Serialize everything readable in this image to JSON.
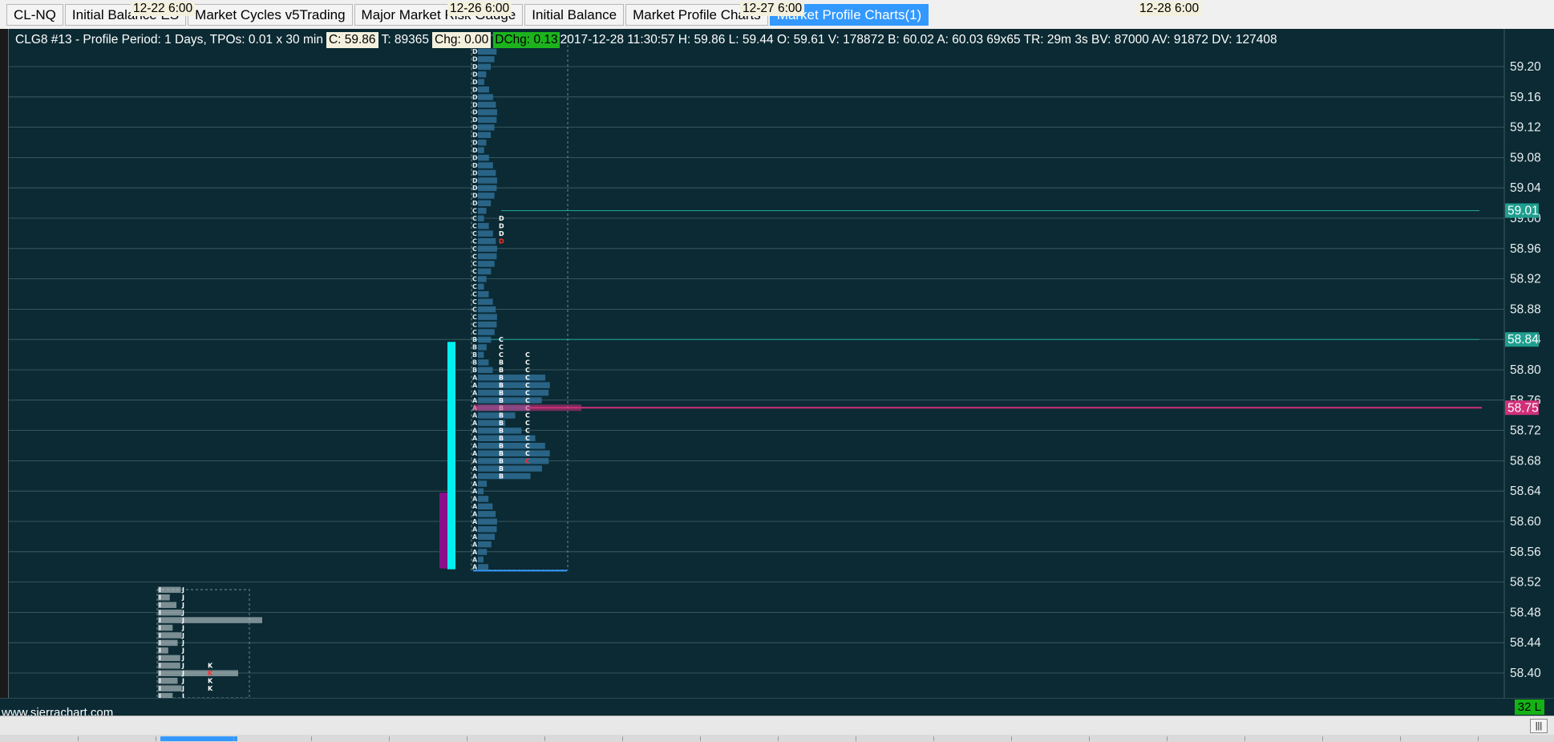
{
  "tabs": [
    {
      "label": "CL-NQ",
      "active": false
    },
    {
      "label": "Initial Balance ES",
      "active": false
    },
    {
      "label": "Market Cycles v5Trading",
      "active": false
    },
    {
      "label": "Major Market Risk Gauge",
      "active": false
    },
    {
      "label": "Initial Balance",
      "active": false
    },
    {
      "label": "Market Profile Charts",
      "active": false
    },
    {
      "label": "Market Profile Charts(1)",
      "active": true
    }
  ],
  "info": {
    "symbol_line": "CLG8  #13 - Profile Period: 1 Days, TPOs: 0.01 x 30 min",
    "c": "C: 59.86",
    "t": "T: 89365",
    "chg": "Chg: 0.00",
    "dchg": "DChg: 0.13",
    "rest": "2017-12-28 11:30:57 H: 59.86 L: 59.44 O: 59.61 V: 178872 B: 60.02 A: 60.03 69x65 TR: 29m 3s BV: 87000 AV: 91872 DV: 127408"
  },
  "price_axis": {
    "labels": [
      "59.20",
      "59.16",
      "59.12",
      "59.08",
      "59.04",
      "59.00",
      "58.96",
      "58.92",
      "58.88",
      "58.84",
      "58.80",
      "58.76",
      "58.72",
      "58.68",
      "58.64",
      "58.60",
      "58.56",
      "58.52",
      "58.48",
      "58.44",
      "58.40"
    ],
    "markers": [
      {
        "label": "59.01",
        "price": 59.01,
        "color": "#1e9e8e"
      },
      {
        "label": "58.84",
        "price": 58.84,
        "color": "#1e9e8e"
      },
      {
        "label": "58.75",
        "price": 58.75,
        "color": "#d0307a"
      }
    ]
  },
  "profiles": {
    "day1": {
      "letters": [
        "I",
        "J",
        "K"
      ]
    },
    "day2": {
      "letters": [
        "A",
        "B",
        "C",
        "D"
      ]
    }
  },
  "time_axis": [
    "12-22  6:00",
    "12-26  6:00",
    "12-27  6:00",
    "12-28  6:00"
  ],
  "watermark": "www.sierrachart.com",
  "status_badge": "32 L",
  "scroll_icon": "|||",
  "colors": {
    "background": "#0b2a33",
    "grid": "#5d7a82",
    "volume": "#2f6e96",
    "value_area_bar": "#00f0f0",
    "ib_bar": "#8a0f8a",
    "poc": "#d0307a"
  }
}
